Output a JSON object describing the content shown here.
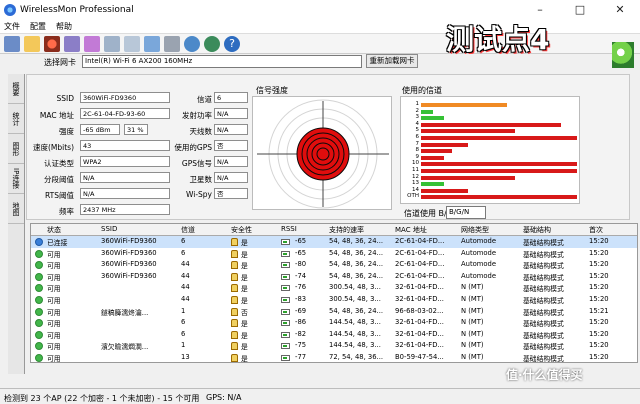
{
  "window": {
    "title": "WirelessMon Professional",
    "minimize": "–",
    "maximize": "□",
    "close": "✕"
  },
  "menu": [
    "文件",
    "配置",
    "帮助"
  ],
  "toolbar_icons": [
    "save-icon",
    "folder-icon",
    "record-icon",
    "settings-icon",
    "network-icon",
    "printer-icon",
    "print-preview-icon",
    "edit-icon",
    "phone-icon",
    "globe-icon",
    "refresh-icon",
    "help-icon"
  ],
  "adapter": {
    "label": "选择网卡",
    "value": "Intel(R) Wi-Fi 6 AX200 160MHz",
    "reload": "重新加载网卡"
  },
  "overlay_title": "测试点4",
  "side_tabs": [
    "概要",
    "统计",
    "图形",
    "IP连接",
    "地图"
  ],
  "info": {
    "ssid_label": "SSID",
    "ssid": "360WiFi-FD9360",
    "mac_label": "MAC 地址",
    "mac": "2C-61-04-FD-93-60",
    "strength_label": "强度",
    "strength_dbm": "-65 dBm",
    "strength_pct": "31 %",
    "rate_label": "速度(Mbits)",
    "rate": "43",
    "auth_label": "认证类型",
    "auth": "WPA2",
    "frag_label": "分段阈值",
    "frag": "N/A",
    "rts_label": "RTS阈值",
    "rts": "N/A",
    "freq_label": "频率",
    "freq": "2437 MHz",
    "channel_label": "信道",
    "channel": "6",
    "tx_label": "发射功率",
    "tx": "N/A",
    "antenna_label": "天线数",
    "antenna": "N/A",
    "gps_used_label": "使用的GPS",
    "gps_used": "否",
    "gps_signal_label": "GPS信号",
    "gps_signal": "N/A",
    "sat_label": "卫星数",
    "sat": "N/A",
    "wispy_label": "Wi-Spy",
    "wispy": "否"
  },
  "radar_title": "信号强度",
  "channel_panel": {
    "title": "使用的信道",
    "usage_label": "信道使用 B/G/N",
    "option": "B/G/N"
  },
  "channel_bars": [
    {
      "ch": "1",
      "color": "#f08a24",
      "len": 0.55
    },
    {
      "ch": "2",
      "color": "#35c135",
      "len": 0.08
    },
    {
      "ch": "3",
      "color": "#35c135",
      "len": 0.15
    },
    {
      "ch": "4",
      "color": "#d81919",
      "len": 0.9
    },
    {
      "ch": "5",
      "color": "#d81919",
      "len": 0.6
    },
    {
      "ch": "6",
      "color": "#d81919",
      "len": 1.0
    },
    {
      "ch": "7",
      "color": "#d81919",
      "len": 0.3
    },
    {
      "ch": "8",
      "color": "#d81919",
      "len": 0.2
    },
    {
      "ch": "9",
      "color": "#d81919",
      "len": 0.15
    },
    {
      "ch": "10",
      "color": "#d81919",
      "len": 1.0
    },
    {
      "ch": "11",
      "color": "#d81919",
      "len": 1.0
    },
    {
      "ch": "12",
      "color": "#d81919",
      "len": 0.6
    },
    {
      "ch": "13",
      "color": "#35c135",
      "len": 0.15
    },
    {
      "ch": "14",
      "color": "#d81919",
      "len": 0.3
    },
    {
      "ch": "OTH",
      "color": "#d81919",
      "len": 1.0
    }
  ],
  "table": {
    "headers": [
      "状态",
      "SSID",
      "信道",
      "安全性",
      "RSSI",
      "支持的速率",
      "MAC 地址",
      "网络类型",
      "基础结构",
      "首次"
    ],
    "rows": [
      {
        "status": "已连接",
        "ssid": "360WiFi-FD9360",
        "ch": "6",
        "sec": "是",
        "rssi": "-65",
        "rate": "54, 48, 36, 24...",
        "mac": "2C-61-04-FD...",
        "net": "Automode",
        "infra": "基础结构模式",
        "first": "15:20"
      },
      {
        "status": "可用",
        "ssid": "360WiFi-FD9360",
        "ch": "6",
        "sec": "是",
        "rssi": "-65",
        "rate": "54, 48, 36, 24...",
        "mac": "2C-61-04-FD...",
        "net": "Automode",
        "infra": "基础结构模式",
        "first": "15:20"
      },
      {
        "status": "可用",
        "ssid": "360WiFi-FD9360",
        "ch": "44",
        "sec": "是",
        "rssi": "-80",
        "rate": "54, 48, 36, 24...",
        "mac": "2C-61-04-FD...",
        "net": "Automode",
        "infra": "基础结构模式",
        "first": "15:20"
      },
      {
        "status": "可用",
        "ssid": "360WiFi-FD9360",
        "ch": "44",
        "sec": "是",
        "rssi": "-74",
        "rate": "54, 48, 36, 24...",
        "mac": "2C-61-04-FD...",
        "net": "Automode",
        "infra": "基础结构模式",
        "first": "15:20"
      },
      {
        "status": "可用",
        "ssid": "",
        "ch": "44",
        "sec": "是",
        "rssi": "-76",
        "rate": "300.54, 48, 3...",
        "mac": "32-61-04-FD...",
        "net": "N (MT)",
        "infra": "基础结构模式",
        "first": "15:20"
      },
      {
        "status": "可用",
        "ssid": "",
        "ch": "44",
        "sec": "是",
        "rssi": "-83",
        "rate": "300.54, 48, 3...",
        "mac": "32-61-04-FD...",
        "net": "N (MT)",
        "infra": "基础结构模式",
        "first": "15:20"
      },
      {
        "status": "可用",
        "ssid": "鐩稿簲濡炵瀹...",
        "ch": "1",
        "sec": "否",
        "rssi": "-69",
        "rate": "54, 48, 36, 24...",
        "mac": "96-68-03-02...",
        "net": "N (MT)",
        "infra": "基础结构模式",
        "first": "15:21"
      },
      {
        "status": "可用",
        "ssid": "",
        "ch": "6",
        "sec": "是",
        "rssi": "-86",
        "rate": "144.54, 48, 3...",
        "mac": "32-61-04-FD...",
        "net": "N (MT)",
        "infra": "基础结构模式",
        "first": "15:20"
      },
      {
        "status": "可用",
        "ssid": "",
        "ch": "6",
        "sec": "是",
        "rssi": "-82",
        "rate": "144.54, 48, 3...",
        "mac": "32-61-04-FD...",
        "net": "N (MT)",
        "infra": "基础结构模式",
        "first": "15:20"
      },
      {
        "status": "可用",
        "ssid": "濱欠瞼濡燜澗...",
        "ch": "1",
        "sec": "是",
        "rssi": "-75",
        "rate": "144.54, 48, 3...",
        "mac": "32-61-04-FD...",
        "net": "N (MT)",
        "infra": "基础结构模式",
        "first": "15:20"
      },
      {
        "status": "可用",
        "ssid": "",
        "ch": "13",
        "sec": "是",
        "rssi": "-77",
        "rate": "72, 54, 48, 36...",
        "mac": "B0-59-47-54...",
        "net": "N (MT)",
        "infra": "基础结构模式",
        "first": "15:20"
      }
    ]
  },
  "status": {
    "ap": "检测到 23 个AP (22 个加密 - 1 个未加密) - 15 个可用",
    "gps": "GPS: N/A"
  },
  "watermark": "值·什么值得买"
}
